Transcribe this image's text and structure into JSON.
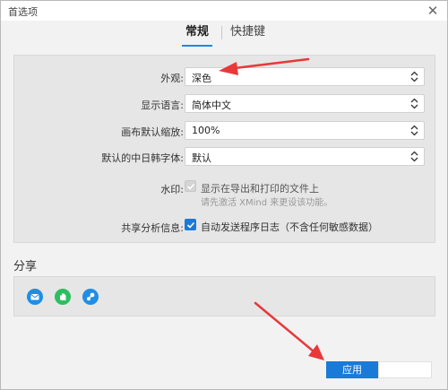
{
  "window": {
    "title": "首选项",
    "close_glyph": "✕"
  },
  "tabs": [
    {
      "label": "常规",
      "active": true
    },
    {
      "label": "快捷键",
      "active": false
    }
  ],
  "settings": {
    "appearance": {
      "label": "外观:",
      "value": "深色"
    },
    "language": {
      "label": "显示语言:",
      "value": "简体中文"
    },
    "zoom": {
      "label": "画布默认缩放:",
      "value": "100%"
    },
    "cjk_font": {
      "label": "默认的中日韩字体:",
      "value": "默认"
    },
    "watermark": {
      "label": "水印:",
      "checkbox_label": "显示在导出和打印的文件上",
      "checked": true,
      "disabled": true,
      "hint": "请先激活 XMind 来更设该功能。"
    },
    "analytics": {
      "label": "共享分析信息:",
      "checkbox_label": "自动发送程序日志（不含任何敏感数据）",
      "checked": true
    }
  },
  "share": {
    "title": "分享",
    "icons": [
      "mail-icon",
      "evernote-icon",
      "link-icon"
    ]
  },
  "footer": {
    "apply_label": "应用"
  },
  "annotations": {
    "arrow_color": "#e8383a"
  },
  "colors": {
    "accent": "#1a7ad8",
    "evernote": "#2dbe60"
  }
}
